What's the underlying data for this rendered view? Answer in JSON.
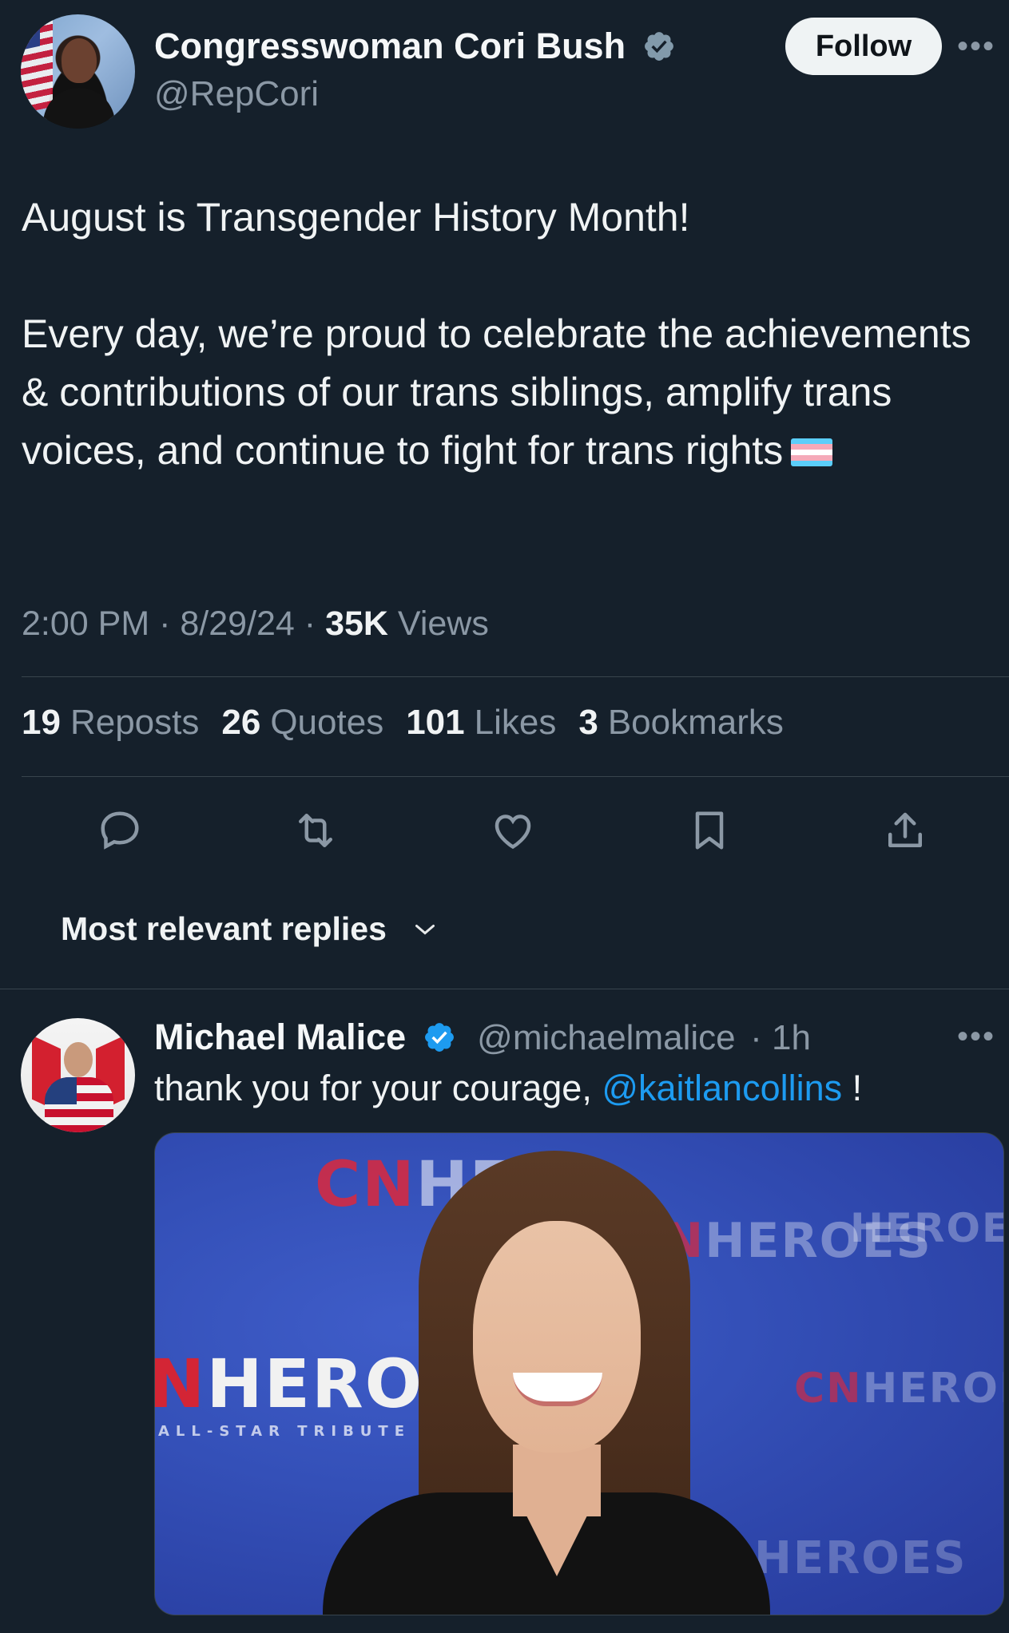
{
  "tweet": {
    "author_name": "Congresswoman Cori Bush",
    "author_handle": "@RepCori",
    "follow_label": "Follow",
    "more_label": "•••",
    "text_line1": "August is Transgender History Month!",
    "text_line2": "Every day, we’re proud to celebrate the achievements & contributions of our trans siblings, amplify trans voices, and continue to fight for trans rights",
    "time": "2:00 PM",
    "date": "8/29/24",
    "views_count": "35K",
    "views_label": "Views",
    "separator": "·"
  },
  "stats": [
    {
      "count": "19",
      "label": "Reposts"
    },
    {
      "count": "26",
      "label": "Quotes"
    },
    {
      "count": "101",
      "label": "Likes"
    },
    {
      "count": "3",
      "label": "Bookmarks"
    }
  ],
  "actions": [
    "reply-icon",
    "repost-icon",
    "like-icon",
    "bookmark-icon",
    "share-icon"
  ],
  "replies_sort": {
    "label": "Most relevant replies",
    "icon": "chevron-down-icon"
  },
  "reply": {
    "author_name": "Michael Malice",
    "author_handle": "@michaelmalice",
    "time": "· 1h",
    "text_before": "thank you for your courage, ",
    "mention": "@kaitlancollins",
    "text_after": " !",
    "more_label": "•••",
    "media_banner_text": "HEROES",
    "media_banner_sub": "ALL-STAR TRIBUTE",
    "media_banner_prefix": "N"
  },
  "colors": {
    "background": "#15202b",
    "text": "#e7e9ea",
    "secondary": "#8b98a5",
    "accent": "#1d9bf0",
    "divider": "#38444d"
  }
}
